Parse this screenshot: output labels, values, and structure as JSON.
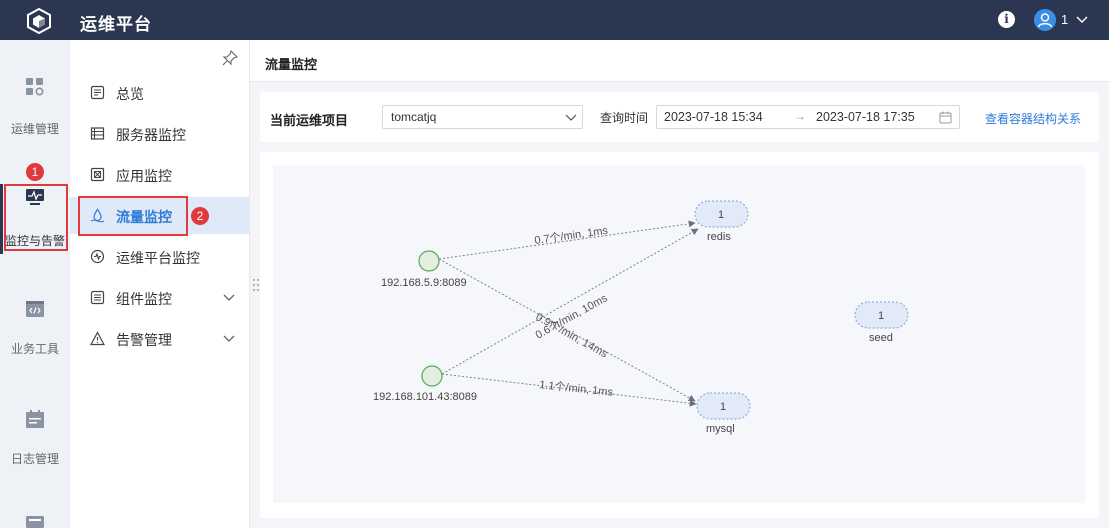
{
  "app": {
    "title": "运维平台",
    "user": "1"
  },
  "rail": [
    {
      "label": "运维管理",
      "icon": "grid-apps-icon"
    },
    {
      "label": "监控与告警",
      "icon": "monitor-icon"
    },
    {
      "label": "业务工具",
      "icon": "code-window-icon"
    },
    {
      "label": "日志管理",
      "icon": "calendar-log-icon"
    }
  ],
  "menu": [
    {
      "label": "总览",
      "icon": "overview-icon"
    },
    {
      "label": "服务器监控",
      "icon": "server-list-icon"
    },
    {
      "label": "应用监控",
      "icon": "app-monitor-icon"
    },
    {
      "label": "流量监控",
      "icon": "traffic-drop-icon"
    },
    {
      "label": "运维平台监控",
      "icon": "platform-monitor-icon"
    },
    {
      "label": "组件监控",
      "icon": "component-icon"
    },
    {
      "label": "告警管理",
      "icon": "alarm-icon"
    }
  ],
  "page": {
    "title": "流量监控"
  },
  "filter": {
    "project_label": "当前运维项目",
    "project_value": "tomcatjq",
    "time_label": "查询时间",
    "start": "2023-07-18 15:34",
    "separator": "→",
    "end": "2023-07-18 17:35",
    "link": "查看容器结构关系"
  },
  "graph": {
    "nodes": [
      {
        "id": "n1",
        "label": "192.168.5.9:8089",
        "kind": "source"
      },
      {
        "id": "n2",
        "label": "192.168.101.43:8089",
        "kind": "source"
      },
      {
        "id": "redis",
        "label": "redis",
        "count": "1",
        "kind": "service"
      },
      {
        "id": "mysql",
        "label": "mysql",
        "count": "1",
        "kind": "service"
      },
      {
        "id": "seed",
        "label": "seed",
        "count": "1",
        "kind": "service"
      }
    ],
    "edges": [
      {
        "from": "n1",
        "to": "redis",
        "label": "0.7个/min, 1ms"
      },
      {
        "from": "n1",
        "to": "mysql",
        "label": "0.9个/min, 14ms"
      },
      {
        "from": "n2",
        "to": "redis",
        "label": "0.6个/min, 10ms"
      },
      {
        "from": "n2",
        "to": "mysql",
        "label": "1.1个/min, 1ms"
      }
    ]
  },
  "annotations": {
    "badge1": "1",
    "badge2": "2"
  },
  "colors": {
    "topbar": "#2b3650",
    "accent": "#2f7bd8",
    "annotation": "#e0393e"
  }
}
